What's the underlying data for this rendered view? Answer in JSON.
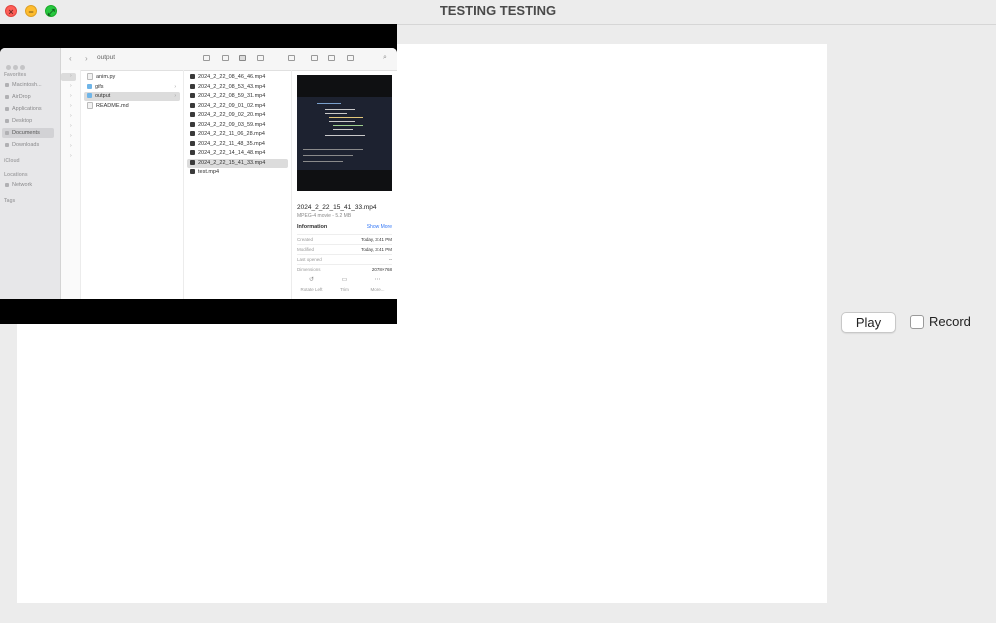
{
  "window": {
    "title": "TESTING TESTING"
  },
  "controls": {
    "play_label": "Play",
    "record_label": "Record",
    "record_checked": false
  },
  "finder": {
    "path": "output",
    "sidebar": {
      "favorites_header": "Favorites",
      "favorites": [
        "Macintosh...",
        "AirDrop",
        "Applications",
        "Desktop",
        "Documents",
        "Downloads"
      ],
      "icloud_header": "iCloud",
      "locations_header": "Locations",
      "locations": [
        "Network"
      ],
      "tags_header": "Tags"
    },
    "folder_items": [
      "anim.py",
      "gifs",
      "output",
      "README.md"
    ],
    "files": [
      "2024_2_22_08_46_46.mp4",
      "2024_2_22_08_53_43.mp4",
      "2024_2_22_08_59_31.mp4",
      "2024_2_22_09_01_02.mp4",
      "2024_2_22_09_02_20.mp4",
      "2024_2_22_09_03_59.mp4",
      "2024_2_22_11_06_28.mp4",
      "2024_2_22_11_48_35.mp4",
      "2024_2_22_14_14_48.mp4",
      "2024_2_22_15_41_33.mp4",
      "test.mp4"
    ],
    "preview": {
      "name": "2024_2_22_15_41_33.mp4",
      "kind": "MPEG-4 movie - 5.2 MB",
      "info_header": "Information",
      "show_more": "Show More",
      "created_label": "Created",
      "created_value": "Today, 3:41 PM",
      "modified_label": "Modified",
      "modified_value": "Today, 3:41 PM",
      "opened_label": "Last opened",
      "opened_value": "--",
      "dimensions_label": "Dimensions",
      "dimensions_value": "2078×768",
      "actions": [
        "Rotate Left",
        "Trim",
        "More..."
      ]
    }
  }
}
